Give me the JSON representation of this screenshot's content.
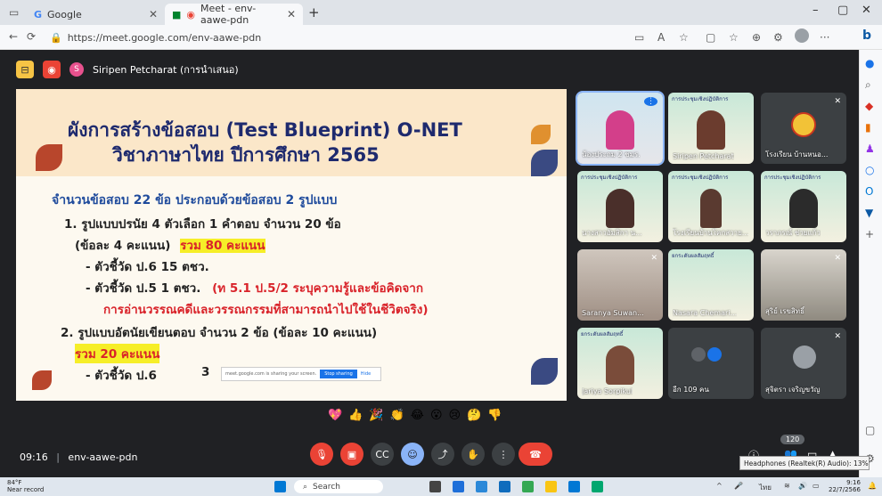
{
  "browser": {
    "tabs": [
      {
        "label": "Google"
      },
      {
        "label": "Meet - env-aawe-pdn"
      }
    ],
    "new_tab": "+",
    "url": "https://meet.google.com/env-aawe-pdn"
  },
  "meet": {
    "presenter_initial": "S",
    "presenter_label": "Siripen Petcharat (การนำเสนอ)",
    "slide": {
      "title_line1": "ผังการสร้างข้อสอบ (Test Blueprint) O-NET",
      "title_line2": "วิชาภาษาไทย    ปีการศึกษา 2565",
      "summary": "จำนวนข้อสอบ  22 ข้อ  ประกอบด้วยข้อสอบ 2 รูปแบบ",
      "item1": "1. รูปแบบปรนัย 4 ตัวเลือก  1 คำตอบ  จำนวน 20 ข้อ",
      "item1_score": "(ข้อละ 4 คะแนน)",
      "item1_total": "รวม 80 คะแนน",
      "indicator1": "-  ตัวชี้วัด ป.6    15  ตชว.",
      "indicator2": "-  ตัวชี้วัด ป.5     1  ตชว.",
      "indicator2_note": "(ท 5.1 ป.5/2 ระบุความรู้และข้อคิดจาก",
      "indicator2_note2": "การอ่านวรรณคดีและวรรณกรรมที่สามารถนำไปใช้ในชีวิตจริง)",
      "item2": "2. รูปแบบอัตนัยเขียนตอบ จำนวน 2 ข้อ (ข้อละ 10 คะแนน)",
      "item2_total": "รวม 20 คะแนน",
      "indicator3": "-  ตัวชี้วัด ป.6",
      "indicator3_count": "3",
      "share_notice": "meet.google.com is sharing your screen.",
      "stop_sharing": "Stop sharing",
      "hide": "Hide"
    },
    "participants": [
      {
        "name": "น้องประถม 2 ชมร."
      },
      {
        "name": "Siripen Petcharat"
      },
      {
        "name": "โรงเรียน บ้านหนอ..."
      },
      {
        "name": "นางสาวอัมสิกา น..."
      },
      {
        "name": "โรงเรียนบ้านโคกสวาย..."
      },
      {
        "name": "วราภรณ์ ช่วยแก้ว"
      },
      {
        "name": "Saranya Suwan..."
      },
      {
        "name": "Nasara Chemari..."
      },
      {
        "name": "สุริย์ เรขสิทธิ์"
      },
      {
        "name": "Jariya Sorpikul"
      },
      {
        "name": "อีก 109 คน"
      },
      {
        "name": "สุจิตรา เจริญขวัญ"
      }
    ],
    "tile_slide_text": "การประชุมเชิงปฏิบัติการ",
    "tile_slide_text2": "ยกระดับผลสัมฤทธิ์",
    "reactions": [
      "💖",
      "👍",
      "🎉",
      "👏",
      "😂",
      "😮",
      "😢",
      "🤔",
      "👎"
    ],
    "meeting_time": "09:16",
    "meeting_code": "env-aawe-pdn",
    "participant_count": "120",
    "audio_tooltip": "Headphones (Realtek(R) Audio): 13%"
  },
  "taskbar": {
    "weather_temp": "84°F",
    "weather_text": "Near record",
    "search_label": "Search",
    "lang": "ไทย",
    "clock_time": "9:16",
    "clock_date": "22/7/2566"
  }
}
